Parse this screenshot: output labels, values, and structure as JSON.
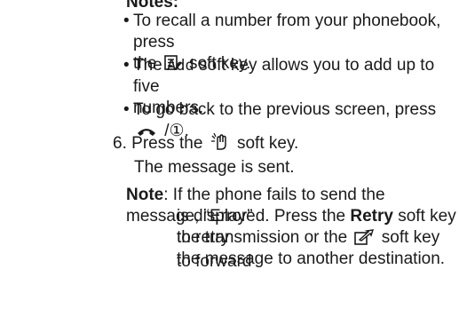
{
  "notes_heading": "Notes:",
  "bullets": [
    {
      "before": "To recall a number from your phonebook, press",
      "line2_before": "the",
      "icon": "phonebook-icon",
      "after": "soft key."
    },
    {
      "before": "The",
      "mono": "Add",
      "after": "soft key allows you to add up to five",
      "line2": "numbers."
    },
    {
      "before": "To go back to the previous screen, press",
      "icon": "end-key-icon",
      "after": "/①."
    }
  ],
  "step6": {
    "number": "6.",
    "before": "Press the",
    "icon": "send-hand-icon",
    "after": "soft key.",
    "result": "The message is sent."
  },
  "note": {
    "label": "Note",
    "line1": ": If the phone fails to send the message, “Error”",
    "line2_before": "is displayed. Press the",
    "retry": "Retry",
    "line2_after": "soft key to retry",
    "line3_before": "the transmission or the",
    "icon": "forward-icon",
    "line3_after": "soft key to forward",
    "line4": "the message to another destination."
  }
}
